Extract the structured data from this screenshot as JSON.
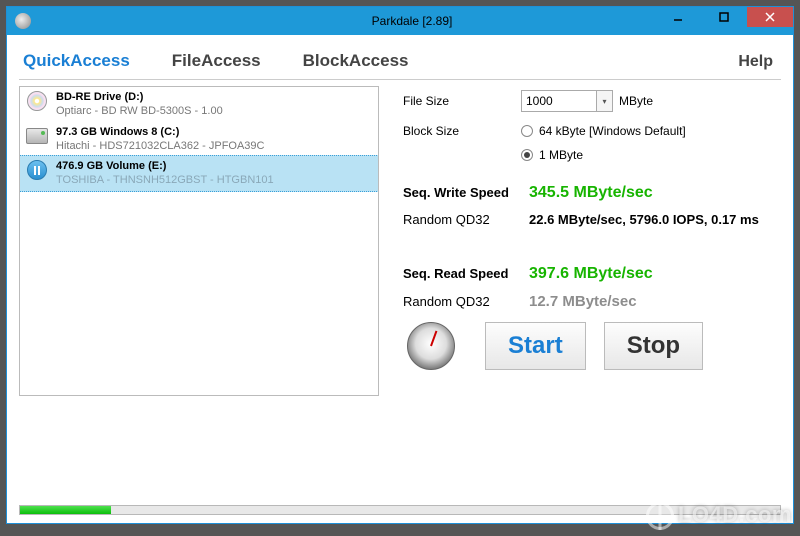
{
  "titlebar": {
    "title": "Parkdale [2.89]"
  },
  "tabs": {
    "quick": "QuickAccess",
    "file": "FileAccess",
    "block": "BlockAccess",
    "help": "Help"
  },
  "drives": [
    {
      "title": "BD-RE Drive (D:)",
      "sub": "Optiarc - BD RW BD-5300S - 1.00",
      "icon": "disc"
    },
    {
      "title": "97.3 GB Windows 8 (C:)",
      "sub": "Hitachi - HDS721032CLA362 - JPFOA39C",
      "icon": "hdd"
    },
    {
      "title": "476.9 GB Volume (E:)",
      "sub": "TOSHIBA - THNSNH512GBST - HTGBN101",
      "icon": "pause",
      "selected": true
    }
  ],
  "settings": {
    "filesize_label": "File Size",
    "filesize_value": "1000",
    "filesize_unit": "MByte",
    "blocksize_label": "Block Size",
    "blocksize_opt1": "64 kByte [Windows Default]",
    "blocksize_opt2": "1 MByte"
  },
  "results": {
    "seq_write_label": "Seq. Write Speed",
    "seq_write_value": "345.5 MByte/sec",
    "rand_write_label": "Random QD32",
    "rand_write_value": "22.6 MByte/sec, 5796.0 IOPS, 0.17 ms",
    "seq_read_label": "Seq. Read Speed",
    "seq_read_value": "397.6 MByte/sec",
    "rand_read_label": "Random QD32",
    "rand_read_value": "12.7 MByte/sec"
  },
  "buttons": {
    "start": "Start",
    "stop": "Stop"
  },
  "progress_percent": 12,
  "watermark": "LO4D.com"
}
